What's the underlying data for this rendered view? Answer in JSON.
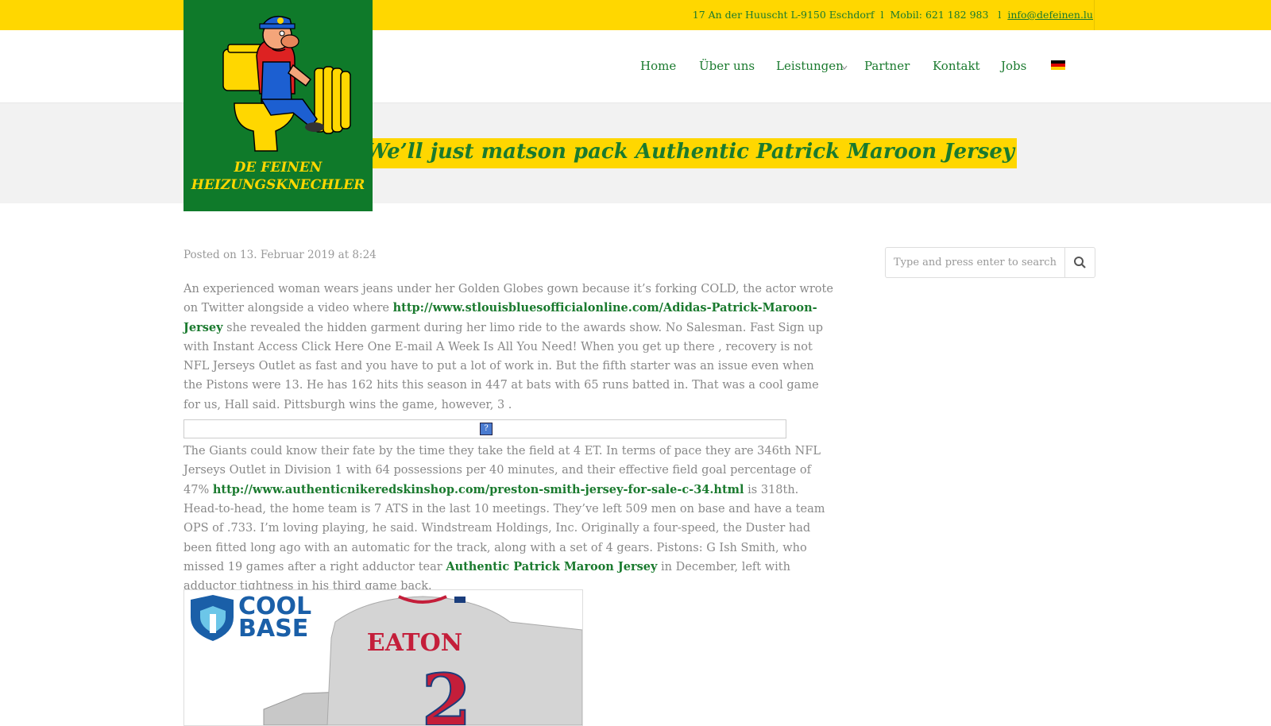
{
  "topbar": {
    "address": "17 An der Huuscht L-9150 Eschdorf",
    "sep1": "l",
    "phone": "Mobil: 621 182 983",
    "sep2": "l",
    "email": "info@defeinen.lu"
  },
  "logo": {
    "line1": "DE FEINEN",
    "line2": "HEIZUNGSKNECHLER"
  },
  "nav": {
    "home": "Home",
    "about": "Über uns",
    "services": "Leistungen",
    "partner": "Partner",
    "contact": "Kontakt",
    "jobs": "Jobs"
  },
  "page": {
    "title": "art We’ll just matson pack Authentic Patrick Maroon Jersey"
  },
  "post": {
    "posted": "Posted on 13. Februar 2019 at 8:24",
    "p1_a": "An experienced woman wears jeans under her Golden Globes gown because it’s forking COLD, the actor wrote on Twitter alongside a video where ",
    "p1_link": "http://www.stlouisbluesofficialonline.com/Adidas-Patrick-Maroon-Jersey",
    "p1_b": " she revealed the hidden garment during her limo ride to the awards show. No Salesman. Fast Sign up with Instant Access Click Here One E-mail A Week Is All You Need! When you get up there , recovery is not NFL Jerseys Outlet as fast and you have to put a lot of work in. But the fifth starter was an issue even when the Pistons were 13. He has 162 hits this season in 447 at bats with 65 runs batted in. That was a cool game for us, Hall said. Pittsburgh wins the game, however, 3 .",
    "embed_icon": "?",
    "p2_a": "The Giants could know their fate by the time they take the field at 4 ET. In terms of pace they are 346th NFL Jerseys Outlet in Division 1 with 64 possessions per 40 minutes, and their effective field goal percentage of 47% ",
    "p2_link": "http://www.authenticnikeredskinshop.com/preston-smith-jersey-for-sale-c-34.html",
    "p2_b": " is 318th. Head-to-head, the home team is 7 ATS in the last 10 meetings. They’ve left 509 men on base and have a team OPS of .733. I’m loving playing, he said. Windstream Holdings, Inc. Originally a four-speed, the Duster had been fitted long ago with an automatic for the track, along with a set of 4 gears. Pistons: G Ish Smith, who missed 19 games after a right adductor tear ",
    "p2_link2": "Authentic Patrick Maroon Jersey",
    "p2_c": " in December, left with adductor tightness in his third game back."
  },
  "jersey_image": {
    "brand_line1": "COOL",
    "brand_line2": "BASE",
    "tm": "™",
    "player": "EATON",
    "number": "2"
  },
  "search": {
    "placeholder": "Type and press enter to search"
  },
  "colors": {
    "yellow": "#ffd700",
    "green": "#1a7a2e",
    "logo_green": "#0f7a2a"
  }
}
